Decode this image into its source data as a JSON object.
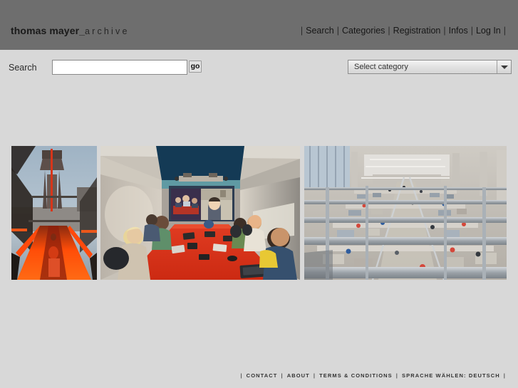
{
  "site": {
    "logo_bold": "thomas mayer",
    "logo_underscore": "_",
    "logo_light": "archive",
    "background_color": "#d8d8d8",
    "header_color": "#6e6e6e"
  },
  "nav": {
    "separator": "|",
    "items": [
      {
        "label": "Search"
      },
      {
        "label": "Categories"
      },
      {
        "label": "Registration"
      },
      {
        "label": "Infos"
      },
      {
        "label": "Log In"
      }
    ]
  },
  "search": {
    "label": "Search",
    "value": "",
    "placeholder": "",
    "go_label": "go"
  },
  "category": {
    "selected": "Select category",
    "arrow_icon": "chevron-down-icon"
  },
  "gallery": {
    "images": [
      {
        "name": "zollverein-escalator",
        "alt": "Zollverein coal mine winding tower with orange illuminated escalator at dusk"
      },
      {
        "name": "video-conference-room",
        "alt": "Meeting room with large red table, seated people and a video conference projection screen"
      },
      {
        "name": "factory-floor-overview",
        "alt": "Elevated view of a large industrial factory hall with steel beams and workstations"
      }
    ]
  },
  "footer": {
    "separator": "|",
    "items": [
      {
        "label": "CONTACT"
      },
      {
        "label": "ABOUT"
      },
      {
        "label": "TERMS & CONDITIONS"
      },
      {
        "label": "SPRACHE WÄHLEN: DEUTSCH"
      }
    ]
  }
}
